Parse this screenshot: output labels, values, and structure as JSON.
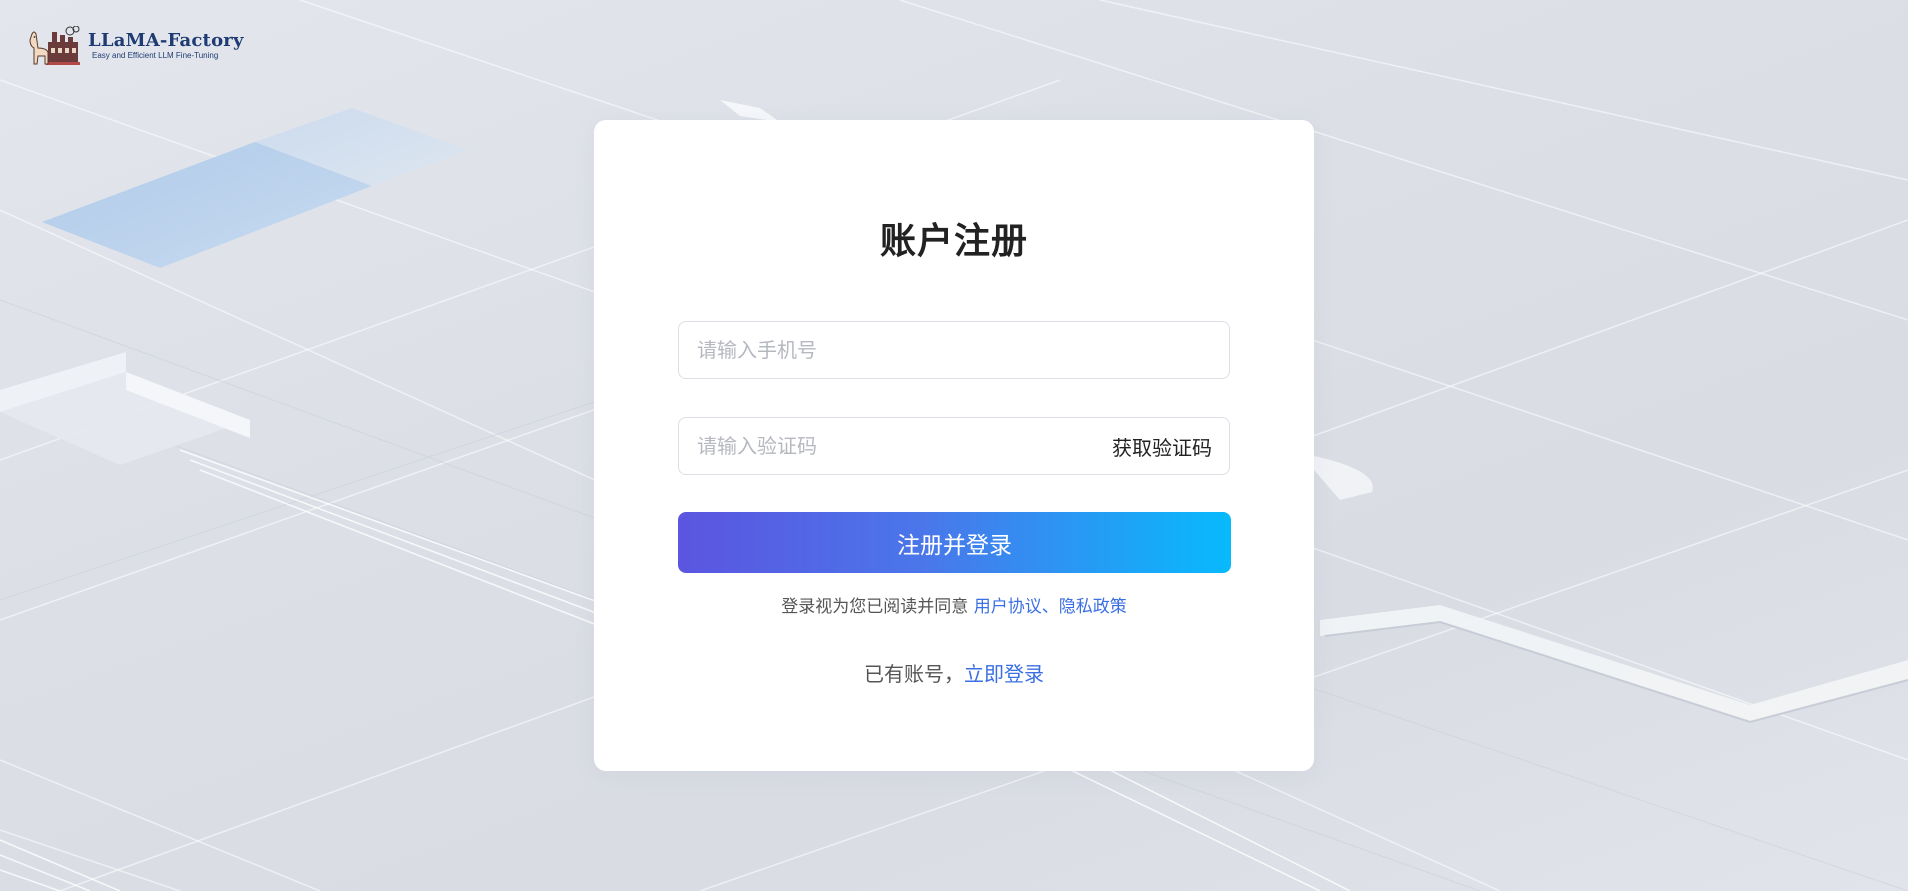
{
  "brand": {
    "name": "LLaMA-Factory",
    "tagline": "Easy and Efficient LLM Fine-Tuning",
    "color": "#1f3b73"
  },
  "form": {
    "title": "账户注册",
    "phone_placeholder": "请输入手机号",
    "phone_value": "",
    "code_placeholder": "请输入验证码",
    "code_value": "",
    "get_code_label": "获取验证码",
    "submit_label": "注册并登录",
    "agree_prefix": "登录视为您已阅读并同意",
    "user_agreement": "用户协议",
    "separator": "、",
    "privacy_policy": "隐私政策",
    "have_account_prefix": "已有账号，",
    "login_link": "立即登录"
  },
  "colors": {
    "accent_link": "#3a6fe3",
    "button_gradient_start": "#5b55e0",
    "button_gradient_end": "#07bafd"
  },
  "icons": [
    "llama-logo-icon"
  ]
}
